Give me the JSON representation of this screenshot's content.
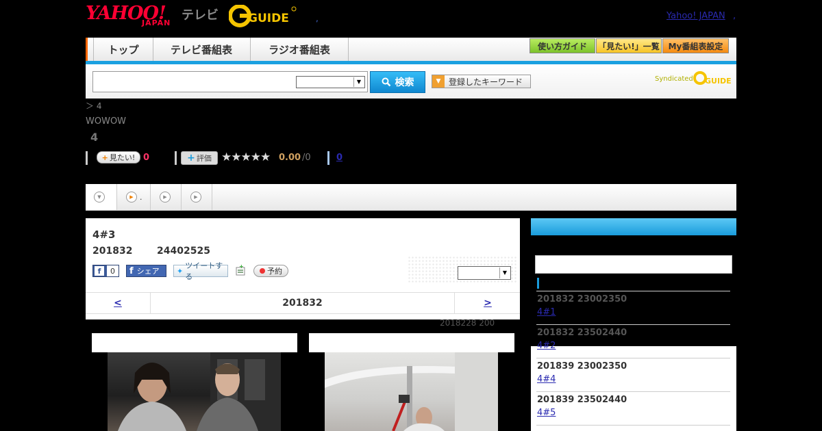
{
  "header": {
    "yahoo_logo": "YAHOO!",
    "yahoo_sub": "JAPAN",
    "tv_label": "テレビ",
    "gguide_logo": "G-GUIDE",
    "head_dot": ",",
    "yahoo_japan_link": "Yahoo! JAPAN",
    "yahoo_japan_dot": ","
  },
  "nav": {
    "tabs": [
      {
        "label": "トップ"
      },
      {
        "label": "テレビ番組表"
      },
      {
        "label": "ラジオ番組表"
      }
    ],
    "buttons": [
      {
        "label": "使い方ガイド"
      },
      {
        "label": "「見たい!」一覧"
      },
      {
        "label": "My番組表設定"
      }
    ]
  },
  "search": {
    "input_value": "",
    "select_value": "",
    "button_label": "検索",
    "keyword_button": "登録したキーワード",
    "syndicated": "Syndicated"
  },
  "program": {
    "breadcrumb": "＞ 4",
    "channel": "WOWOW",
    "title": "4",
    "mitai_label": "見たい!",
    "mitai_count": "0",
    "hyoka_label": "評価",
    "stars": "★★★★★",
    "score": "0.00",
    "score_sub": "/0",
    "review_link": "0"
  },
  "tabs": [
    {
      "label": ""
    },
    {
      "label": "."
    },
    {
      "label": ""
    },
    {
      "label": ""
    }
  ],
  "episode": {
    "title": "4#3",
    "date": "201832",
    "time": "24402525",
    "fb_like_count": "0",
    "fb_share_label": "シェア",
    "tweet_label": "ツイートする",
    "yoyaku_label": "予約",
    "select_value": "",
    "date_prev": "<",
    "date_current": "201832",
    "date_next": ">",
    "updated": "2018228  200"
  },
  "sidebar": {
    "items": [
      {
        "datetime": "201832  23002350",
        "link": "4#1",
        "dim": true
      },
      {
        "datetime": "201832  23502440",
        "link": "4#2",
        "dim": true
      },
      {
        "datetime": "201839  23002350",
        "link": "4#4",
        "dim": false
      },
      {
        "datetime": "201839  23502440",
        "link": "4#5",
        "dim": false
      }
    ]
  },
  "colors": {
    "accent_blue": "#1aa0e0",
    "nav_green": "#8fd03a",
    "nav_yellow": "#ffd23a",
    "nav_orange": "#ff9a22",
    "link": "#2a2ab0"
  }
}
